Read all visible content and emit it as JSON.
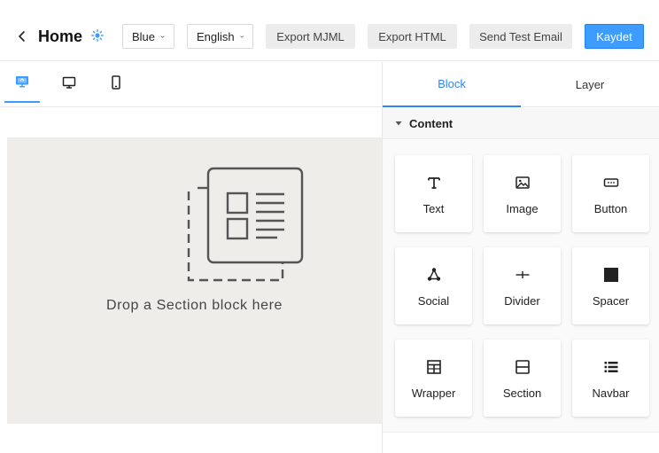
{
  "header": {
    "title": "Home",
    "theme_select": "Blue",
    "language_select": "English",
    "export_mjml": "Export MJML",
    "export_html": "Export HTML",
    "send_test_email": "Send Test Email",
    "save": "Kaydet",
    "accent_color": "#3e9cff"
  },
  "device_tabs": [
    {
      "icon": "desktop-preview-icon",
      "active": true
    },
    {
      "icon": "monitor-icon",
      "active": false
    },
    {
      "icon": "mobile-icon",
      "active": false
    }
  ],
  "canvas": {
    "drop_text": "Drop a Section block here",
    "background": "#efede9"
  },
  "panel": {
    "tabs": [
      "Block",
      "Layer"
    ],
    "active_tab": "Block",
    "section_title": "Content",
    "blocks": [
      {
        "label": "Text",
        "icon": "text-icon"
      },
      {
        "label": "Image",
        "icon": "image-icon"
      },
      {
        "label": "Button",
        "icon": "button-icon"
      },
      {
        "label": "Social",
        "icon": "social-icon"
      },
      {
        "label": "Divider",
        "icon": "divider-icon"
      },
      {
        "label": "Spacer",
        "icon": "spacer-icon"
      },
      {
        "label": "Wrapper",
        "icon": "wrapper-icon"
      },
      {
        "label": "Section",
        "icon": "section-icon"
      },
      {
        "label": "Navbar",
        "icon": "navbar-icon"
      }
    ]
  }
}
